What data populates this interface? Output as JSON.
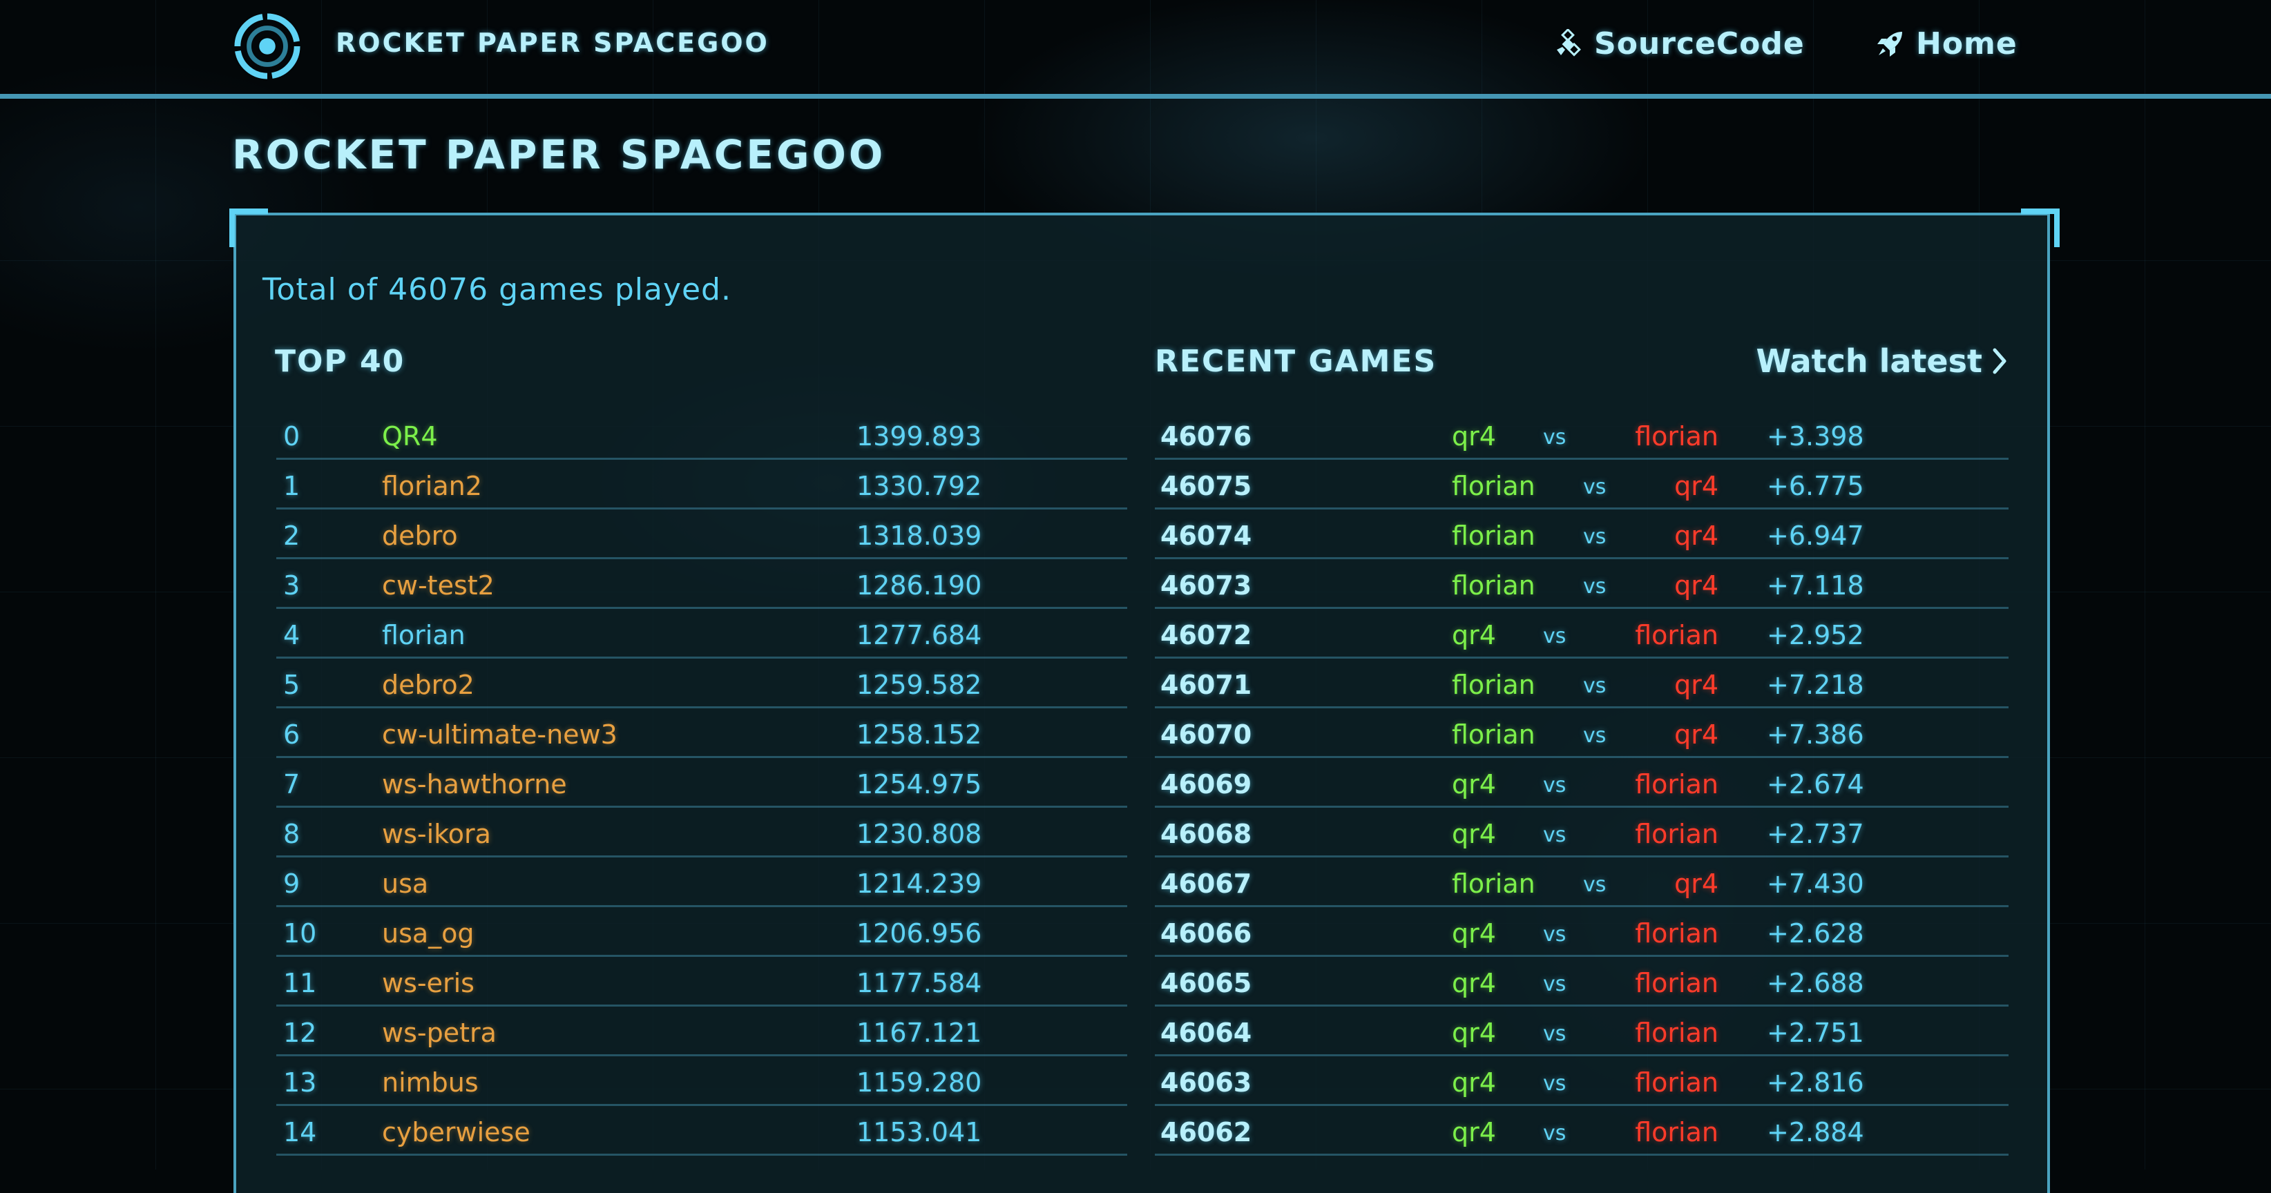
{
  "header": {
    "title": "Rocket Paper Spacegoo",
    "nav": [
      {
        "label": "SourceCode",
        "icon": "satellite-icon"
      },
      {
        "label": "Home",
        "icon": "rocket-icon"
      }
    ]
  },
  "page": {
    "title": "Rocket Paper Spacegoo",
    "total_text": "Total of 46076 games played."
  },
  "top": {
    "title": "TOP 40",
    "rows": [
      {
        "rank": "0",
        "name": "QR4",
        "score": "1399.893",
        "color": "green"
      },
      {
        "rank": "1",
        "name": "florian2",
        "score": "1330.792",
        "color": "gold"
      },
      {
        "rank": "2",
        "name": "debro",
        "score": "1318.039",
        "color": "gold"
      },
      {
        "rank": "3",
        "name": "cw-test2",
        "score": "1286.190",
        "color": "gold"
      },
      {
        "rank": "4",
        "name": "florian",
        "score": "1277.684",
        "color": "blue"
      },
      {
        "rank": "5",
        "name": "debro2",
        "score": "1259.582",
        "color": "gold"
      },
      {
        "rank": "6",
        "name": "cw-ultimate-new3",
        "score": "1258.152",
        "color": "gold"
      },
      {
        "rank": "7",
        "name": "ws-hawthorne",
        "score": "1254.975",
        "color": "gold"
      },
      {
        "rank": "8",
        "name": "ws-ikora",
        "score": "1230.808",
        "color": "gold"
      },
      {
        "rank": "9",
        "name": "usa",
        "score": "1214.239",
        "color": "gold"
      },
      {
        "rank": "10",
        "name": "usa_og",
        "score": "1206.956",
        "color": "gold"
      },
      {
        "rank": "11",
        "name": "ws-eris",
        "score": "1177.584",
        "color": "gold"
      },
      {
        "rank": "12",
        "name": "ws-petra",
        "score": "1167.121",
        "color": "gold"
      },
      {
        "rank": "13",
        "name": "nimbus",
        "score": "1159.280",
        "color": "gold"
      },
      {
        "rank": "14",
        "name": "cyberwiese",
        "score": "1153.041",
        "color": "gold"
      }
    ]
  },
  "recent": {
    "title": "RECENT GAMES",
    "watch_latest": "Watch latest",
    "vs_label": "vs",
    "rows": [
      {
        "id": "46076",
        "winner": "qr4",
        "loser": "florian",
        "delta": "+3.398"
      },
      {
        "id": "46075",
        "winner": "florian",
        "loser": "qr4",
        "delta": "+6.775"
      },
      {
        "id": "46074",
        "winner": "florian",
        "loser": "qr4",
        "delta": "+6.947"
      },
      {
        "id": "46073",
        "winner": "florian",
        "loser": "qr4",
        "delta": "+7.118"
      },
      {
        "id": "46072",
        "winner": "qr4",
        "loser": "florian",
        "delta": "+2.952"
      },
      {
        "id": "46071",
        "winner": "florian",
        "loser": "qr4",
        "delta": "+7.218"
      },
      {
        "id": "46070",
        "winner": "florian",
        "loser": "qr4",
        "delta": "+7.386"
      },
      {
        "id": "46069",
        "winner": "qr4",
        "loser": "florian",
        "delta": "+2.674"
      },
      {
        "id": "46068",
        "winner": "qr4",
        "loser": "florian",
        "delta": "+2.737"
      },
      {
        "id": "46067",
        "winner": "florian",
        "loser": "qr4",
        "delta": "+7.430"
      },
      {
        "id": "46066",
        "winner": "qr4",
        "loser": "florian",
        "delta": "+2.628"
      },
      {
        "id": "46065",
        "winner": "qr4",
        "loser": "florian",
        "delta": "+2.688"
      },
      {
        "id": "46064",
        "winner": "qr4",
        "loser": "florian",
        "delta": "+2.751"
      },
      {
        "id": "46063",
        "winner": "qr4",
        "loser": "florian",
        "delta": "+2.816"
      },
      {
        "id": "46062",
        "winner": "qr4",
        "loser": "florian",
        "delta": "+2.884"
      }
    ]
  },
  "colors": {
    "accent": "#5fd3f5",
    "heading": "#b8f0fb",
    "winner": "#7cf04a",
    "loser": "#ff3b2a",
    "player": "#e8a040",
    "border": "#4aa3c0"
  }
}
